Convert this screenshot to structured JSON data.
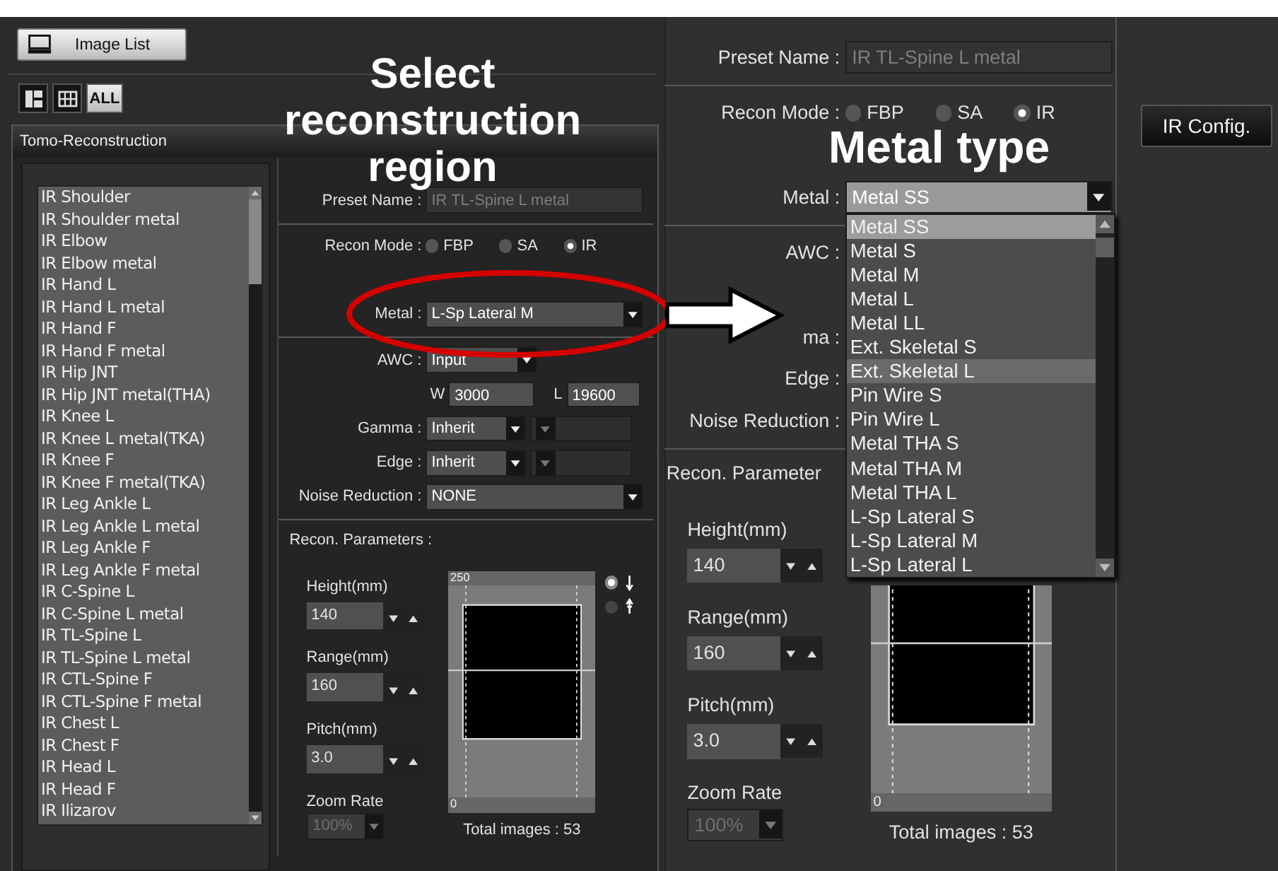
{
  "captions": {
    "region": "Select reconstruction region",
    "metal_type": "Metal type"
  },
  "toolbar": {
    "image_list": "Image List",
    "all": "ALL"
  },
  "panel_title": "Tomo-Reconstruction",
  "presets": [
    "IR Shoulder",
    "IR Shoulder metal",
    "IR Elbow",
    "IR Elbow metal",
    "IR Hand L",
    "IR Hand L metal",
    "IR Hand F",
    "IR Hand F metal",
    "IR Hip JNT",
    "IR Hip JNT metal(THA)",
    "IR Knee L",
    "IR Knee L metal(TKA)",
    "IR Knee F",
    "IR Knee F metal(TKA)",
    "IR Leg Ankle L",
    "IR Leg Ankle L metal",
    "IR Leg Ankle F",
    "IR Leg Ankle F metal",
    "IR C-Spine L",
    "IR C-Spine L metal",
    "IR TL-Spine L",
    "IR TL-Spine L metal",
    "IR CTL-Spine F",
    "IR CTL-Spine F metal",
    "IR Chest L",
    "IR Chest F",
    "IR Head L",
    "IR Head F",
    "IR Ilizarov"
  ],
  "forms": [
    {
      "preset_label": "Preset Name :",
      "preset_name": "IR TL-Spine L metal",
      "mode_label": "Recon Mode :",
      "modes": [
        {
          "label": "FBP",
          "selected": false
        },
        {
          "label": "SA",
          "selected": false
        },
        {
          "label": "IR",
          "selected": true
        }
      ],
      "metal_label": "Metal :",
      "metal": "L-Sp Lateral M",
      "awc_label": "AWC :",
      "awc": "Input",
      "window_label": "W",
      "window_value": "3000",
      "level_label": "L",
      "level_value": "19600",
      "gamma_label": "Gamma :",
      "gamma": "Inherit",
      "edge_label": "Edge :",
      "edge": "Inherit",
      "noise_label": "Noise Reduction :",
      "noise": "NONE",
      "params_label": "Recon. Parameters :",
      "params": [
        {
          "label": "Height(mm)",
          "value": "140"
        },
        {
          "label": "Range(mm)",
          "value": "160"
        },
        {
          "label": "Pitch(mm)",
          "value": "3.0"
        }
      ],
      "zoom_label": "Zoom Rate",
      "zoom": "100%",
      "zoom_disabled": true,
      "scale_max": "250",
      "scale_min": "0",
      "directions": [
        {
          "kind": "down",
          "selected": true
        },
        {
          "kind": "up",
          "selected": false
        }
      ],
      "total": "Total images : 53"
    },
    {
      "preset_label": "Preset Name :",
      "preset_name": "IR TL-Spine L metal",
      "mode_label": "Recon Mode :",
      "modes": [
        {
          "label": "FBP",
          "selected": false
        },
        {
          "label": "SA",
          "selected": false
        },
        {
          "label": "IR",
          "selected": true
        }
      ],
      "metal_label": "Metal :",
      "metal": "Metal SS",
      "metal_options": [
        {
          "label": "Metal SS",
          "selected": true,
          "highlighted": false
        },
        {
          "label": "Metal S",
          "selected": false,
          "highlighted": false
        },
        {
          "label": "Metal M",
          "selected": false,
          "highlighted": false
        },
        {
          "label": "Metal L",
          "selected": false,
          "highlighted": false
        },
        {
          "label": "Metal LL",
          "selected": false,
          "highlighted": false
        },
        {
          "label": "Ext. Skeletal S",
          "selected": false,
          "highlighted": false
        },
        {
          "label": "Ext. Skeletal L",
          "selected": false,
          "highlighted": true
        },
        {
          "label": "Pin Wire S",
          "selected": false,
          "highlighted": false
        },
        {
          "label": "Pin Wire L",
          "selected": false,
          "highlighted": false
        },
        {
          "label": "Metal THA S",
          "selected": false,
          "highlighted": false
        },
        {
          "label": "Metal THA M",
          "selected": false,
          "highlighted": false
        },
        {
          "label": "Metal THA L",
          "selected": false,
          "highlighted": false
        },
        {
          "label": "L-Sp Lateral S",
          "selected": false,
          "highlighted": false
        },
        {
          "label": "L-Sp Lateral M",
          "selected": false,
          "highlighted": false
        },
        {
          "label": "L-Sp Lateral L",
          "selected": false,
          "highlighted": false
        }
      ],
      "awc_label": "AWC :",
      "gamma_label": "ma :",
      "edge_label": "Edge :",
      "noise_label": "Noise Reduction :",
      "params_label": "Recon. Parameter",
      "params": [
        {
          "label": "Height(mm)",
          "value": "140"
        },
        {
          "label": "Range(mm)",
          "value": "160"
        },
        {
          "label": "Pitch(mm)",
          "value": "3.0"
        }
      ],
      "zoom_label": "Zoom Rate",
      "zoom": "100%",
      "zoom_disabled": true,
      "scale_min": "0",
      "total": "Total images : 53"
    }
  ],
  "ir_config": "IR Config."
}
